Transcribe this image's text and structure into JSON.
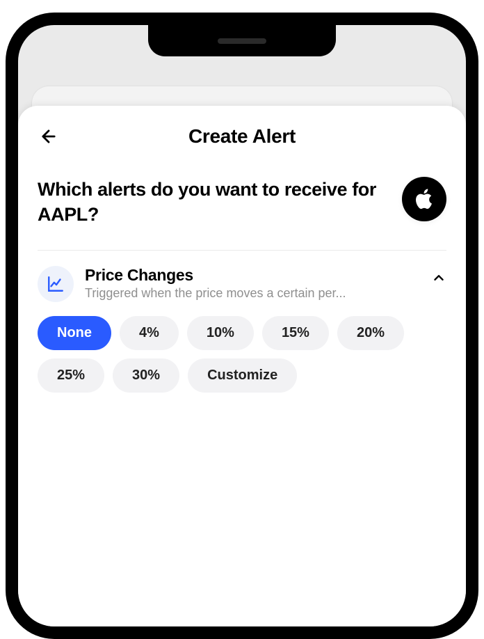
{
  "header": {
    "title": "Create Alert"
  },
  "question": {
    "prefix": "Which alerts do you want to receive for ",
    "ticker": "AAPL",
    "suffix": "?"
  },
  "section": {
    "title": "Price Changes",
    "description": "Triggered when the price moves a certain per..."
  },
  "options": [
    {
      "label": "None",
      "selected": true
    },
    {
      "label": "4%",
      "selected": false
    },
    {
      "label": "10%",
      "selected": false
    },
    {
      "label": "15%",
      "selected": false
    },
    {
      "label": "20%",
      "selected": false
    },
    {
      "label": "25%",
      "selected": false
    },
    {
      "label": "30%",
      "selected": false
    },
    {
      "label": "Customize",
      "selected": false
    }
  ]
}
